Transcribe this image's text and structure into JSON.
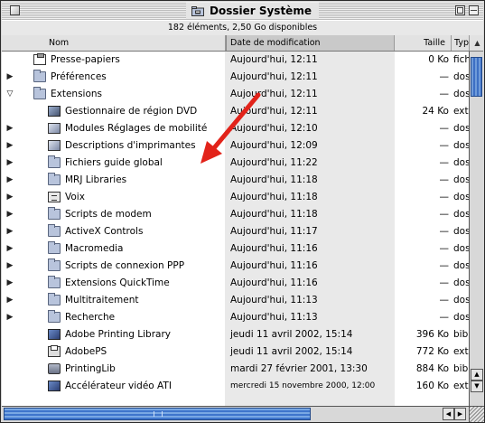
{
  "window": {
    "title": "Dossier Système",
    "info": "182 éléments, 2,50 Go disponibles"
  },
  "columns": {
    "name": "Nom",
    "date": "Date de modification",
    "size": "Taille",
    "type": "Typ",
    "sort_indicator": "▲"
  },
  "rows": [
    {
      "disclosure": "",
      "icon": "clipboard-icon",
      "name": "Presse-papiers",
      "date": "Aujourd'hui, 12:11",
      "size": "0 Ko",
      "type": "fich",
      "indent": 0
    },
    {
      "disclosure": "▶",
      "icon": "folder-icon",
      "name": "Préférences",
      "date": "Aujourd'hui, 12:11",
      "size": "—",
      "type": "doss",
      "indent": 0
    },
    {
      "disclosure": "▽",
      "icon": "extensions-folder-icon",
      "name": "Extensions",
      "date": "Aujourd'hui, 12:11",
      "size": "—",
      "type": "doss",
      "indent": 0
    },
    {
      "disclosure": "",
      "icon": "control-strip-icon",
      "name": "Gestionnaire de région DVD",
      "date": "Aujourd'hui, 12:11",
      "size": "24 Ko",
      "type": "exte",
      "indent": 1
    },
    {
      "disclosure": "▶",
      "icon": "modules-folder-icon",
      "name": "Modules Réglages de mobilité",
      "date": "Aujourd'hui, 12:10",
      "size": "—",
      "type": "doss",
      "indent": 1
    },
    {
      "disclosure": "▶",
      "icon": "printer-folder-icon",
      "name": "Descriptions d'imprimantes",
      "date": "Aujourd'hui, 12:09",
      "size": "—",
      "type": "doss",
      "indent": 1
    },
    {
      "disclosure": "▶",
      "icon": "folder-icon",
      "name": "Fichiers guide global",
      "date": "Aujourd'hui, 11:22",
      "size": "—",
      "type": "doss",
      "indent": 1
    },
    {
      "disclosure": "▶",
      "icon": "folder-icon",
      "name": "MRJ Libraries",
      "date": "Aujourd'hui, 11:18",
      "size": "—",
      "type": "doss",
      "indent": 1
    },
    {
      "disclosure": "▶",
      "icon": "voice-folder-icon",
      "name": "Voix",
      "date": "Aujourd'hui, 11:18",
      "size": "—",
      "type": "doss",
      "indent": 1
    },
    {
      "disclosure": "▶",
      "icon": "folder-icon",
      "name": "Scripts de modem",
      "date": "Aujourd'hui, 11:18",
      "size": "—",
      "type": "doss",
      "indent": 1
    },
    {
      "disclosure": "▶",
      "icon": "folder-icon",
      "name": "ActiveX Controls",
      "date": "Aujourd'hui, 11:17",
      "size": "—",
      "type": "doss",
      "indent": 1
    },
    {
      "disclosure": "▶",
      "icon": "folder-icon",
      "name": "Macromedia",
      "date": "Aujourd'hui, 11:16",
      "size": "—",
      "type": "doss",
      "indent": 1
    },
    {
      "disclosure": "▶",
      "icon": "folder-icon",
      "name": "Scripts de connexion PPP",
      "date": "Aujourd'hui, 11:16",
      "size": "—",
      "type": "doss",
      "indent": 1
    },
    {
      "disclosure": "▶",
      "icon": "folder-icon",
      "name": "Extensions QuickTime",
      "date": "Aujourd'hui, 11:16",
      "size": "—",
      "type": "doss",
      "indent": 1
    },
    {
      "disclosure": "▶",
      "icon": "folder-icon",
      "name": "Multitraitement",
      "date": "Aujourd'hui, 11:13",
      "size": "—",
      "type": "doss",
      "indent": 1
    },
    {
      "disclosure": "▶",
      "icon": "folder-icon",
      "name": "Recherche",
      "date": "Aujourd'hui, 11:13",
      "size": "—",
      "type": "doss",
      "indent": 1
    },
    {
      "disclosure": "",
      "icon": "library-icon",
      "name": "Adobe Printing Library",
      "date": "jeudi 11 avril 2002, 15:14",
      "size": "396 Ko",
      "type": "bibl",
      "indent": 1
    },
    {
      "disclosure": "",
      "icon": "printer-icon",
      "name": "AdobePS",
      "date": "jeudi 11 avril 2002, 15:14",
      "size": "772 Ko",
      "type": "exte",
      "indent": 1
    },
    {
      "disclosure": "",
      "icon": "printing-lib-icon",
      "name": "PrintingLib",
      "date": "mardi 27 février 2001, 13:30",
      "size": "884 Ko",
      "type": "bibl",
      "indent": 1
    },
    {
      "disclosure": "",
      "icon": "video-accelerator-icon",
      "name": "Accélérateur vidéo ATI",
      "date": "mercredi 15 novembre 2000, 12:00",
      "size": "160 Ko",
      "type": "exte",
      "indent": 1,
      "small_date": true
    }
  ],
  "colors": {
    "arrow": "#e2231a",
    "scroll_thumb": "#3d6fc4"
  }
}
